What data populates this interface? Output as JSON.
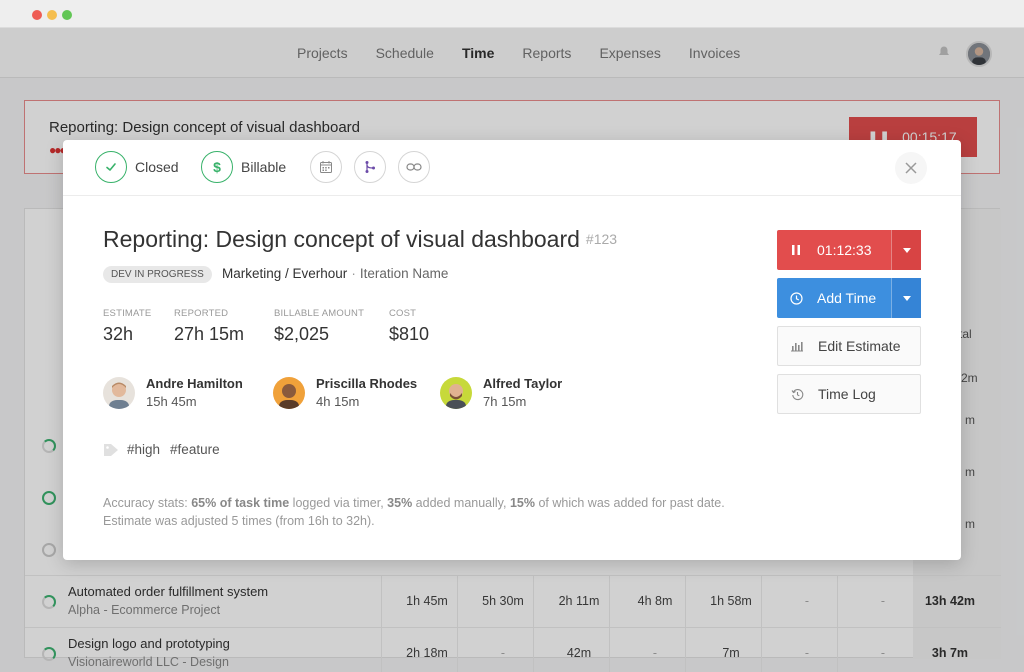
{
  "nav": {
    "items": [
      {
        "label": "Projects",
        "active": false
      },
      {
        "label": "Schedule",
        "active": false
      },
      {
        "label": "Time",
        "active": true
      },
      {
        "label": "Reports",
        "active": false
      },
      {
        "label": "Expenses",
        "active": false
      },
      {
        "label": "Invoices",
        "active": false
      }
    ]
  },
  "background": {
    "banner_title": "Reporting: Design concept of visual dashboard",
    "banner_timer": "00:15:17",
    "side_labels": {
      "total": "tal",
      "row0": "2m",
      "row1": "m",
      "row2": "m",
      "row3": "m"
    },
    "rows": [
      {
        "title": "Automated order fulfillment system",
        "subtitle": "Alpha - Ecommerce Project",
        "cells": [
          "1h 45m",
          "5h 30m",
          "2h 11m",
          "4h 8m",
          "1h 58m",
          "-",
          "-"
        ],
        "total": "13h 42m"
      },
      {
        "title": "Design logo and prototyping",
        "subtitle": "Visionaireworld LLC - Design",
        "cells": [
          "2h 18m",
          "-",
          "42m",
          "-",
          "7m",
          "-",
          "-"
        ],
        "total": "3h 7m"
      }
    ]
  },
  "modal": {
    "header": {
      "closed_label": "Closed",
      "billable_label": "Billable"
    },
    "title": "Reporting: Design concept of visual dashboard",
    "task_number": "#123",
    "status": "DEV IN PROGRESS",
    "project": "Marketing / Everhour",
    "separator": "·",
    "iteration": "Iteration Name",
    "stats": {
      "estimate_label": "ESTIMATE",
      "estimate_value": "32h",
      "reported_label": "REPORTED",
      "reported_value": "27h 15m",
      "billable_label": "BILLABLE AMOUNT",
      "billable_value": "$2,025",
      "cost_label": "COST",
      "cost_value": "$810"
    },
    "members": [
      {
        "name": "Andre Hamilton",
        "time": "15h 45m"
      },
      {
        "name": "Priscilla Rhodes",
        "time": "4h 15m"
      },
      {
        "name": "Alfred Taylor",
        "time": "7h 15m"
      }
    ],
    "tags": [
      "#high",
      "#feature"
    ],
    "accuracy": {
      "p1": "Accuracy stats: ",
      "b1": "65% of task time",
      "p2": " logged via timer, ",
      "b2": "35%",
      "p3": " added manually, ",
      "b3": "15%",
      "p4": " of which was added for past date. Estimate was adjusted 5 times (from 16h to 32h)."
    },
    "actions": {
      "timer": "01:12:33",
      "add_time": "Add Time",
      "edit_estimate": "Edit Estimate",
      "time_log": "Time Log"
    }
  },
  "colors": {
    "accent_red": "#e24d4d",
    "accent_blue": "#3d8fdf",
    "accent_green": "#38b26a"
  }
}
